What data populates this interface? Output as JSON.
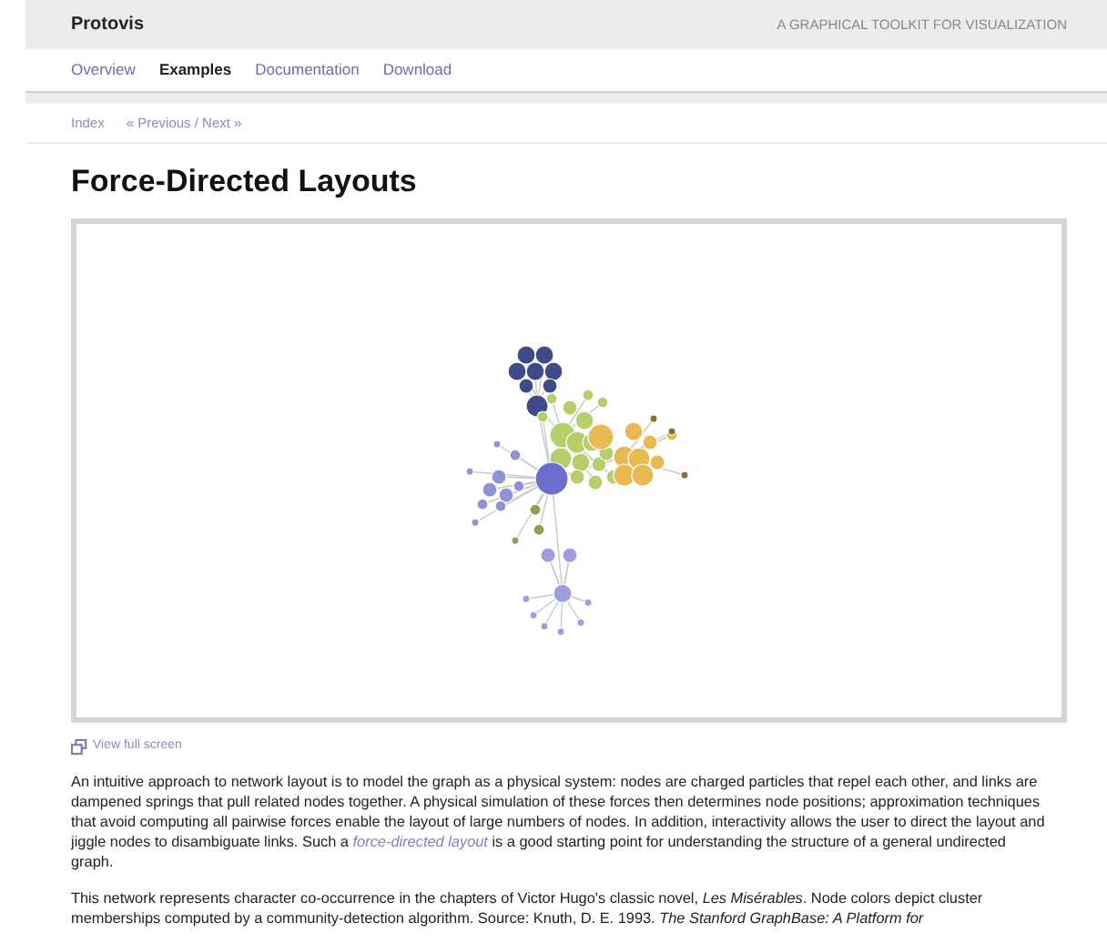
{
  "header": {
    "brand": "Protovis",
    "tagline": "A GRAPHICAL TOOLKIT FOR VISUALIZATION"
  },
  "nav": [
    {
      "label": "Overview",
      "selected": false
    },
    {
      "label": "Examples",
      "selected": true
    },
    {
      "label": "Documentation",
      "selected": false
    },
    {
      "label": "Download",
      "selected": false
    }
  ],
  "breadcrumb": [
    {
      "label": "Index"
    },
    {
      "label": "« Previous / Next »"
    }
  ],
  "title": "Force-Directed Layouts",
  "full_screen_link": "View full screen",
  "paragraph_1": {
    "before": "An intuitive approach to network layout is to model the graph as a physical system: nodes are charged particles that repel each other, and links are dampened springs that pull related nodes together. A physical simulation of these forces then determines node positions; approximation techniques that avoid computing all pairwise forces enable the layout of large numbers of nodes. In addition, interactivity allows the user to direct the layout and jiggle nodes to disambiguate links. Such a",
    "link": "force-directed layout",
    "after": "is a good starting point for understanding the structure of a general undirected graph."
  },
  "paragraph_2": "This network represents character co-occurrence in the chapters of Victor Hugo's classic novel, *Les Misérables*. Node colors depict cluster memberships computed by a community-detection algorithm. Source: Knuth, D. E. 1993. *The Stanford GraphBase: A Platform for*"
}
